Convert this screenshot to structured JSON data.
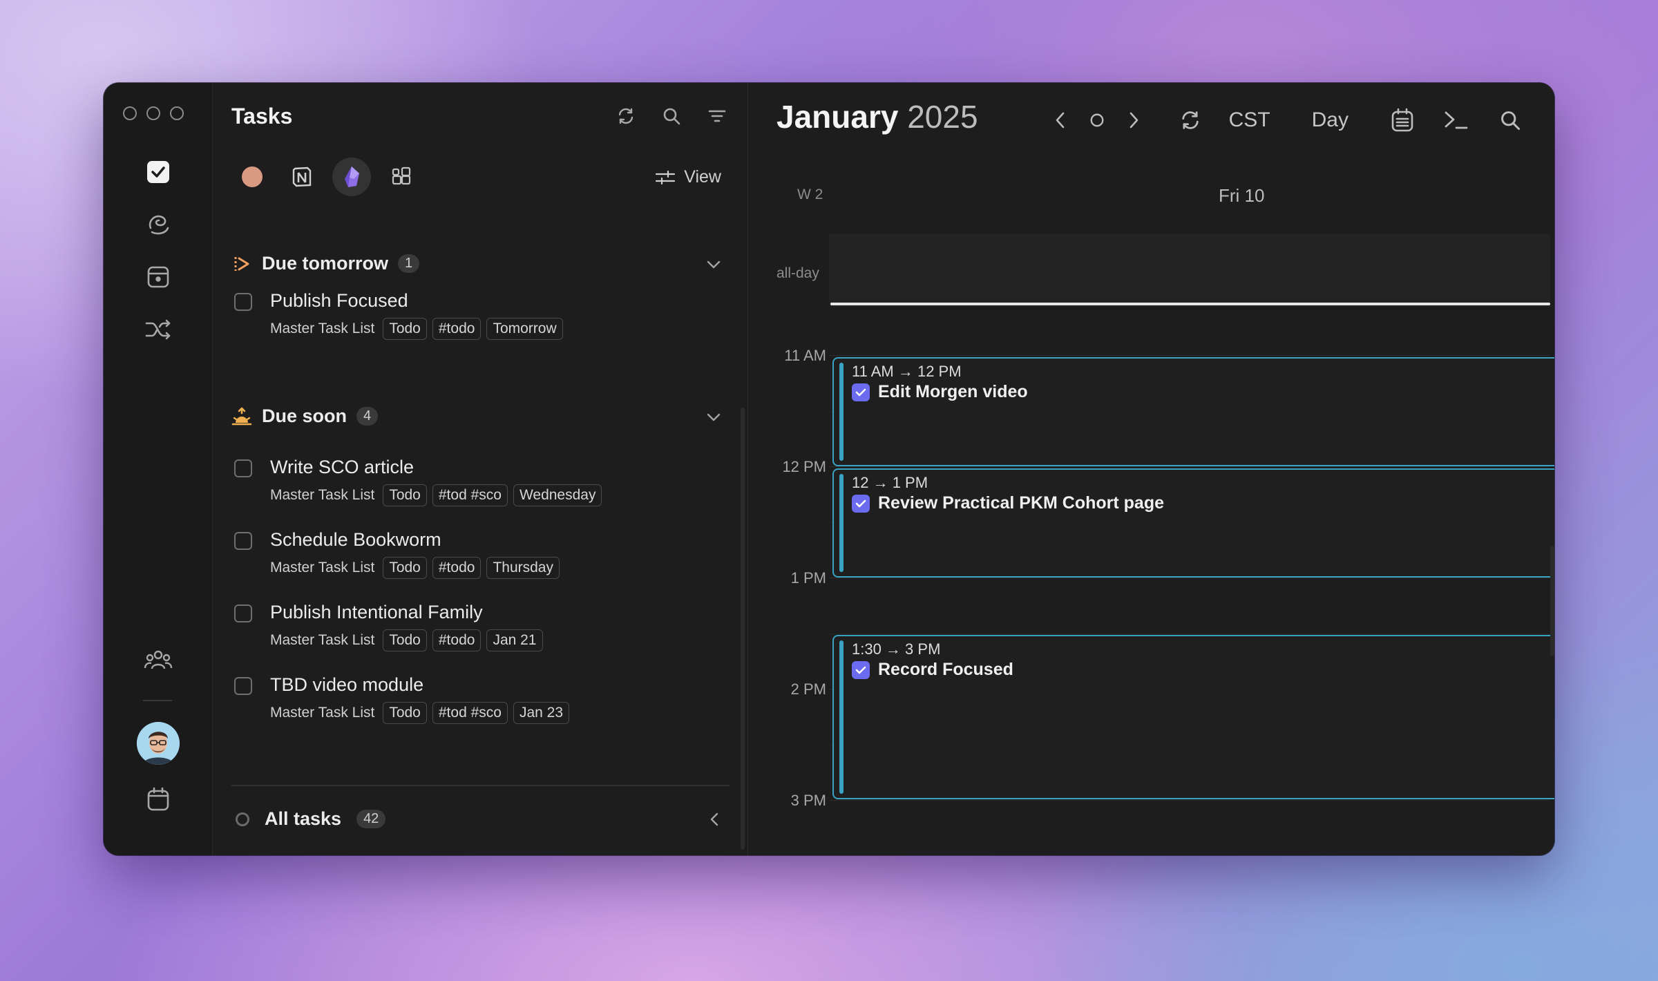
{
  "rail": {
    "items": [
      {
        "name": "tasks",
        "icon": "checkbox-icon"
      },
      {
        "name": "scribble",
        "icon": "scribble-icon"
      },
      {
        "name": "inbox",
        "icon": "inbox-icon"
      },
      {
        "name": "shuffle",
        "icon": "shuffle-icon"
      },
      {
        "name": "people",
        "icon": "people-icon"
      },
      {
        "name": "calendar",
        "icon": "calendar-icon"
      }
    ]
  },
  "tasks_panel": {
    "title": "Tasks",
    "view_label": "View",
    "groups": [
      {
        "title": "Due tomorrow",
        "count": "1",
        "icon": "forward-arrow-icon",
        "tasks": [
          {
            "name": "Publish Focused",
            "list": "Master Task List",
            "chips": [
              "Todo",
              "#todo",
              "Tomorrow"
            ]
          }
        ]
      },
      {
        "title": "Due soon",
        "count": "4",
        "icon": "sunrise-icon",
        "tasks": [
          {
            "name": "Write SCO article",
            "list": "Master Task List",
            "chips": [
              "Todo",
              "#tod #sco",
              "Wednesday"
            ]
          },
          {
            "name": "Schedule Bookworm",
            "list": "Master Task List",
            "chips": [
              "Todo",
              "#todo",
              "Thursday"
            ]
          },
          {
            "name": "Publish Intentional Family",
            "list": "Master Task List",
            "chips": [
              "Todo",
              "#todo",
              "Jan 21"
            ]
          },
          {
            "name": "TBD video module",
            "list": "Master Task List",
            "chips": [
              "Todo",
              "#tod #sco",
              "Jan 23"
            ]
          }
        ]
      }
    ],
    "all_tasks": {
      "label": "All tasks",
      "count": "42"
    }
  },
  "calendar": {
    "month": "January",
    "year": "2025",
    "timezone": "CST",
    "view": "Day",
    "week": "W 2",
    "day": "Fri 10",
    "all_day_label": "all-day",
    "hours": [
      "11 AM",
      "12 PM",
      "1 PM",
      "2 PM",
      "3 PM"
    ],
    "events": [
      {
        "time": "11 AM → 12 PM",
        "title": "Edit Morgen video"
      },
      {
        "time": "12 → 1 PM",
        "title": "Review Practical PKM Cohort page"
      },
      {
        "time": "1:30 → 3 PM",
        "title": "Record Focused"
      }
    ]
  },
  "colors": {
    "accent": "#6b6bf0",
    "event_border": "#3aa3c4",
    "due_tomorrow": "#f0a060",
    "due_soon": "#f0b050",
    "obsidian": "#8e6ee6"
  }
}
